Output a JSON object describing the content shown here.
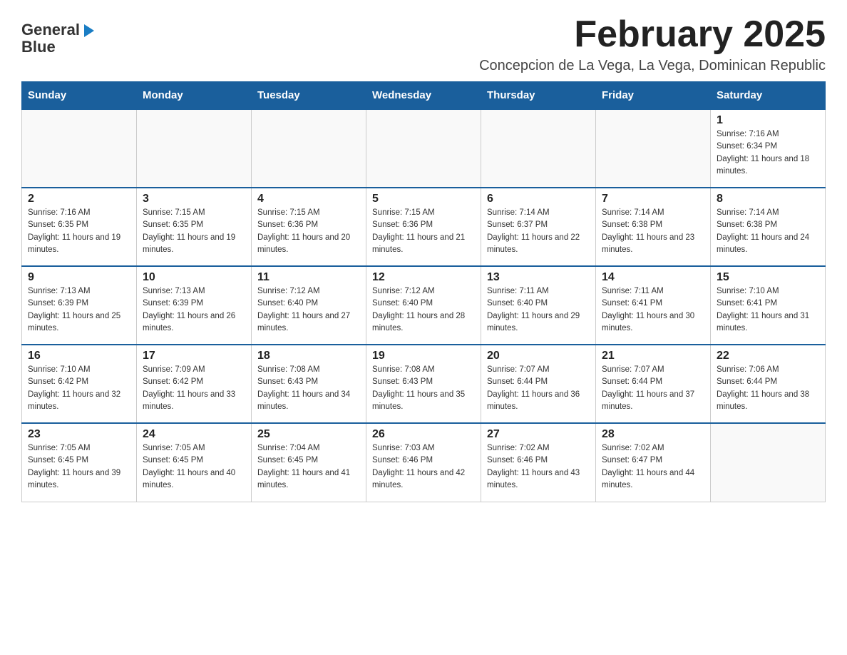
{
  "header": {
    "logo_line1": "General",
    "logo_arrow": "▶",
    "logo_line2": "Blue",
    "month_title": "February 2025",
    "location": "Concepcion de La Vega, La Vega, Dominican Republic"
  },
  "weekdays": [
    "Sunday",
    "Monday",
    "Tuesday",
    "Wednesday",
    "Thursday",
    "Friday",
    "Saturday"
  ],
  "weeks": [
    [
      {
        "day": "",
        "info": ""
      },
      {
        "day": "",
        "info": ""
      },
      {
        "day": "",
        "info": ""
      },
      {
        "day": "",
        "info": ""
      },
      {
        "day": "",
        "info": ""
      },
      {
        "day": "",
        "info": ""
      },
      {
        "day": "1",
        "info": "Sunrise: 7:16 AM\nSunset: 6:34 PM\nDaylight: 11 hours and 18 minutes."
      }
    ],
    [
      {
        "day": "2",
        "info": "Sunrise: 7:16 AM\nSunset: 6:35 PM\nDaylight: 11 hours and 19 minutes."
      },
      {
        "day": "3",
        "info": "Sunrise: 7:15 AM\nSunset: 6:35 PM\nDaylight: 11 hours and 19 minutes."
      },
      {
        "day": "4",
        "info": "Sunrise: 7:15 AM\nSunset: 6:36 PM\nDaylight: 11 hours and 20 minutes."
      },
      {
        "day": "5",
        "info": "Sunrise: 7:15 AM\nSunset: 6:36 PM\nDaylight: 11 hours and 21 minutes."
      },
      {
        "day": "6",
        "info": "Sunrise: 7:14 AM\nSunset: 6:37 PM\nDaylight: 11 hours and 22 minutes."
      },
      {
        "day": "7",
        "info": "Sunrise: 7:14 AM\nSunset: 6:38 PM\nDaylight: 11 hours and 23 minutes."
      },
      {
        "day": "8",
        "info": "Sunrise: 7:14 AM\nSunset: 6:38 PM\nDaylight: 11 hours and 24 minutes."
      }
    ],
    [
      {
        "day": "9",
        "info": "Sunrise: 7:13 AM\nSunset: 6:39 PM\nDaylight: 11 hours and 25 minutes."
      },
      {
        "day": "10",
        "info": "Sunrise: 7:13 AM\nSunset: 6:39 PM\nDaylight: 11 hours and 26 minutes."
      },
      {
        "day": "11",
        "info": "Sunrise: 7:12 AM\nSunset: 6:40 PM\nDaylight: 11 hours and 27 minutes."
      },
      {
        "day": "12",
        "info": "Sunrise: 7:12 AM\nSunset: 6:40 PM\nDaylight: 11 hours and 28 minutes."
      },
      {
        "day": "13",
        "info": "Sunrise: 7:11 AM\nSunset: 6:40 PM\nDaylight: 11 hours and 29 minutes."
      },
      {
        "day": "14",
        "info": "Sunrise: 7:11 AM\nSunset: 6:41 PM\nDaylight: 11 hours and 30 minutes."
      },
      {
        "day": "15",
        "info": "Sunrise: 7:10 AM\nSunset: 6:41 PM\nDaylight: 11 hours and 31 minutes."
      }
    ],
    [
      {
        "day": "16",
        "info": "Sunrise: 7:10 AM\nSunset: 6:42 PM\nDaylight: 11 hours and 32 minutes."
      },
      {
        "day": "17",
        "info": "Sunrise: 7:09 AM\nSunset: 6:42 PM\nDaylight: 11 hours and 33 minutes."
      },
      {
        "day": "18",
        "info": "Sunrise: 7:08 AM\nSunset: 6:43 PM\nDaylight: 11 hours and 34 minutes."
      },
      {
        "day": "19",
        "info": "Sunrise: 7:08 AM\nSunset: 6:43 PM\nDaylight: 11 hours and 35 minutes."
      },
      {
        "day": "20",
        "info": "Sunrise: 7:07 AM\nSunset: 6:44 PM\nDaylight: 11 hours and 36 minutes."
      },
      {
        "day": "21",
        "info": "Sunrise: 7:07 AM\nSunset: 6:44 PM\nDaylight: 11 hours and 37 minutes."
      },
      {
        "day": "22",
        "info": "Sunrise: 7:06 AM\nSunset: 6:44 PM\nDaylight: 11 hours and 38 minutes."
      }
    ],
    [
      {
        "day": "23",
        "info": "Sunrise: 7:05 AM\nSunset: 6:45 PM\nDaylight: 11 hours and 39 minutes."
      },
      {
        "day": "24",
        "info": "Sunrise: 7:05 AM\nSunset: 6:45 PM\nDaylight: 11 hours and 40 minutes."
      },
      {
        "day": "25",
        "info": "Sunrise: 7:04 AM\nSunset: 6:45 PM\nDaylight: 11 hours and 41 minutes."
      },
      {
        "day": "26",
        "info": "Sunrise: 7:03 AM\nSunset: 6:46 PM\nDaylight: 11 hours and 42 minutes."
      },
      {
        "day": "27",
        "info": "Sunrise: 7:02 AM\nSunset: 6:46 PM\nDaylight: 11 hours and 43 minutes."
      },
      {
        "day": "28",
        "info": "Sunrise: 7:02 AM\nSunset: 6:47 PM\nDaylight: 11 hours and 44 minutes."
      },
      {
        "day": "",
        "info": ""
      }
    ]
  ]
}
